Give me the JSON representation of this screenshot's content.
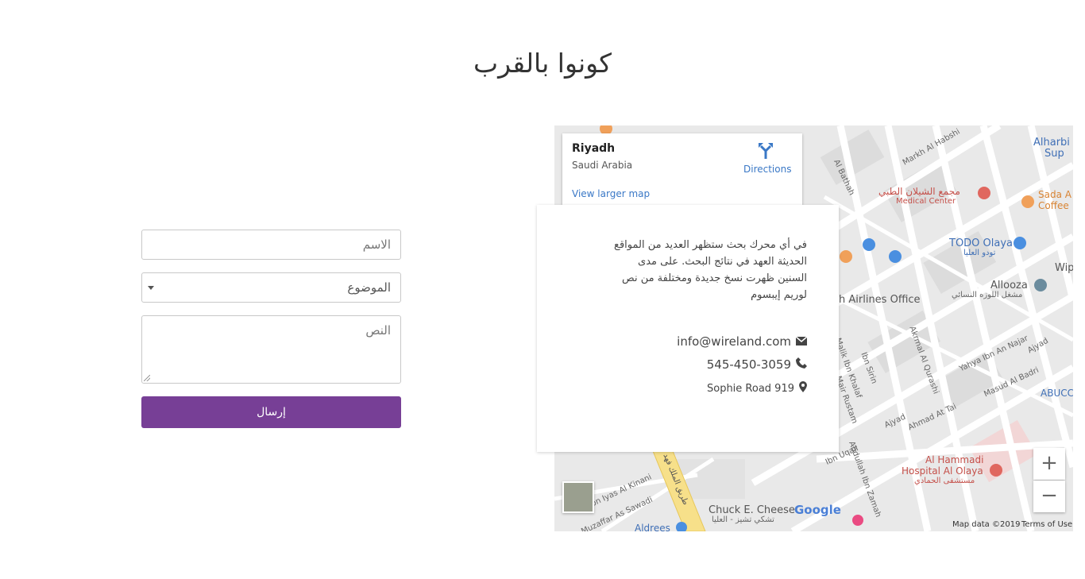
{
  "title": "كونوا بالقرب",
  "form": {
    "name_placeholder": "الاسم",
    "subject_value": "الموضوع",
    "text_placeholder": "النص",
    "send_label": "إرسال",
    "accent_color": "#773f96"
  },
  "map": {
    "place_name": "Riyadh",
    "country": "Saudi Arabia",
    "directions_label": "Directions",
    "larger_map_label": "View larger map",
    "zoom_in": "+",
    "zoom_out": "−",
    "map_data": "Map data ©2019",
    "terms": "Terms of Use",
    "google": "Google",
    "labels": {
      "alharbi": "Alharbi &",
      "sup": "Sup",
      "medical_ar": "مجمع الشيلان الطبي",
      "medical_en": "Medical Center",
      "sada": "Sada A",
      "coffee": "Coffee",
      "todo": "TODO Olaya",
      "todo_ar": "تودو العليا",
      "allooza": "Allooza",
      "allooza_ar": "مشغل اللوزه النسائي",
      "airlines": "h Airlines Office",
      "hammadi": "Al Hammadi",
      "hospital": "Hospital Al Olaya",
      "hospital_ar": "مستشفى الحمادي",
      "abucc": "ABUCC",
      "chuck": "Chuck E. Cheese",
      "chuck_ar": "تشكي تشيز - العليا",
      "aldrees": "Aldrees",
      "wip": "Wip",
      "road_markh": "Markh Al Habshi",
      "road_albathah": "Al Bathah",
      "road_ibnsirin": "Ibn Sirin",
      "road_akrmal": "Akrmal Al Qurashi",
      "road_yahya": "Yahya Ibn An Najar",
      "road_ajyad": "Ajyad",
      "road_masud": "Masud Al Badri",
      "road_ahmad": "Ahmad At Tai",
      "road_ibnuqail": "Ibn Uqail",
      "road_abdullah": "Abdullah Ibn Zamah",
      "road_ilyas": "Ibn Iyas Al Kinani",
      "road_muzaffar": "Muzaffar As Sawadi",
      "road_malik": "Malik Ibn Khalaf",
      "road_rustam": "Mair Rustam",
      "road_kingfahd": "طريق الملك فهد"
    }
  },
  "info": {
    "text": "في أي محرك بحث ستظهر العديد من المواقع الحديثة العهد في نتائج البحث. على مدى السنين ظهرت نسخ جديدة ومختلفة من نص لوريم إيبسوم",
    "email": "info@wireland.com",
    "phone": "545-450-3059",
    "address": "Sophie Road 919"
  }
}
